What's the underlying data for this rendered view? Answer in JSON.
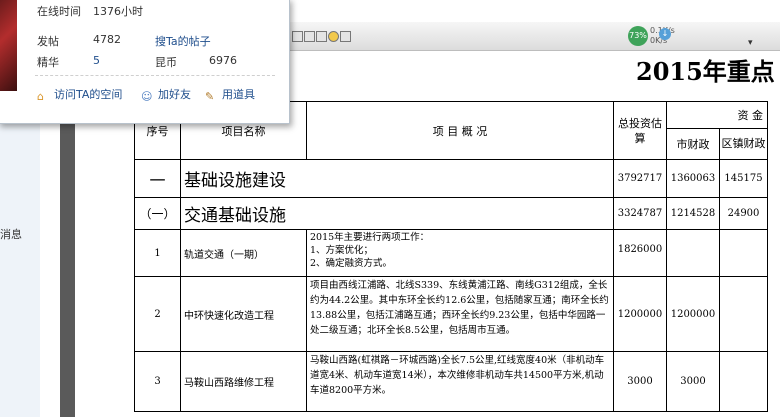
{
  "sidebar_label": "消息",
  "card": {
    "online_label": "在线时间",
    "online_value": "1376小时",
    "posts_label": "发帖",
    "posts_value": "4782",
    "search_posts_link": "搜Ta的帖子",
    "essence_label": "精华",
    "essence_value": "5",
    "coins_label": "昆币",
    "coins_value": "6976",
    "actions": [
      "访问TA的空间",
      "加好友",
      "用道具"
    ]
  },
  "viewer": {
    "zoom_label": "73%",
    "speed_up": "0.1K/s",
    "speed_down": "0K/s"
  },
  "document": {
    "title": "2015年重点",
    "headers": {
      "index": "序号",
      "name": "项目名称",
      "overview": "项 目 概 况",
      "total_investment": "总投资估 算",
      "funding": "资 金",
      "city_finance": "市财政",
      "district_finance": "区镇财政"
    },
    "rows": [
      {
        "index": "一",
        "name": "基础设施建设",
        "overview": "",
        "total": "3792717",
        "city": "1360063",
        "district": "145175",
        "kind": "section"
      },
      {
        "index": "（一）",
        "name": "交通基础设施",
        "overview": "",
        "total": "3324787",
        "city": "1214528",
        "district": "24900",
        "kind": "subsection"
      },
      {
        "index": "1",
        "name": "轨道交通（一期）",
        "overview": "2015年主要进行两项工作：\n1、方案优化；\n2、确定融资方式。",
        "total": "1826000",
        "city": "",
        "district": "",
        "kind": "item"
      },
      {
        "index": "2",
        "name": "中环快速化改造工程",
        "overview": "项目由西线江浦路、北线S339、东线黄浦江路、南线G312组成，全长约为44.2公里。其中东环全长约12.6公里，包括随家互通；南环全长约13.88公里，包括江浦路互通；西环全长约9.23公里，包括中华园路一处二级互通；北环全长8.5公里，包括周市互通。",
        "total": "1200000",
        "city": "1200000",
        "district": "",
        "kind": "item"
      },
      {
        "index": "3",
        "name": "马鞍山西路维修工程",
        "overview": "马鞍山西路(虹祺路－环城西路)全长7.5公里,红线宽度40米（非机动车道宽4米、机动车道宽14米），本次维修非机动车共14500平方米,机动车道8200平方米。",
        "total": "3000",
        "city": "3000",
        "district": "",
        "kind": "item"
      }
    ]
  }
}
